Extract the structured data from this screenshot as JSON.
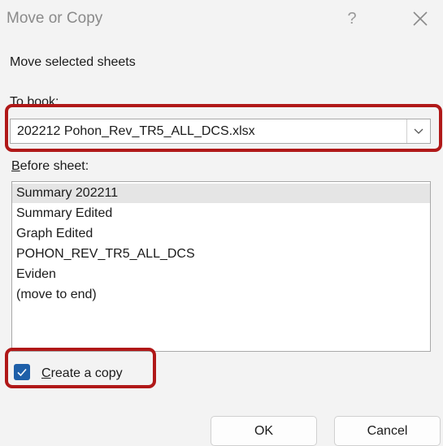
{
  "dialog": {
    "title": "Move or Copy",
    "help_label": "?",
    "subtitle": "Move selected sheets"
  },
  "to_book": {
    "label_accel": "T",
    "label_rest": "o book:",
    "selected_value": "202212 Pohon_Rev_TR5_ALL_DCS.xlsx"
  },
  "before_sheet": {
    "label_accel": "B",
    "label_rest": "efore sheet:",
    "items": [
      "Summary 202211",
      "Summary Edited",
      "Graph Edited",
      "POHON_REV_TR5_ALL_DCS",
      "Eviden",
      "(move to end)"
    ],
    "selected_index": 0
  },
  "create_copy": {
    "label_accel": "C",
    "label_rest": "reate a copy",
    "checked": true
  },
  "buttons": {
    "ok": "OK",
    "cancel": "Cancel"
  },
  "colors": {
    "highlight": "#b01818",
    "checkbox": "#1e5fa8"
  }
}
